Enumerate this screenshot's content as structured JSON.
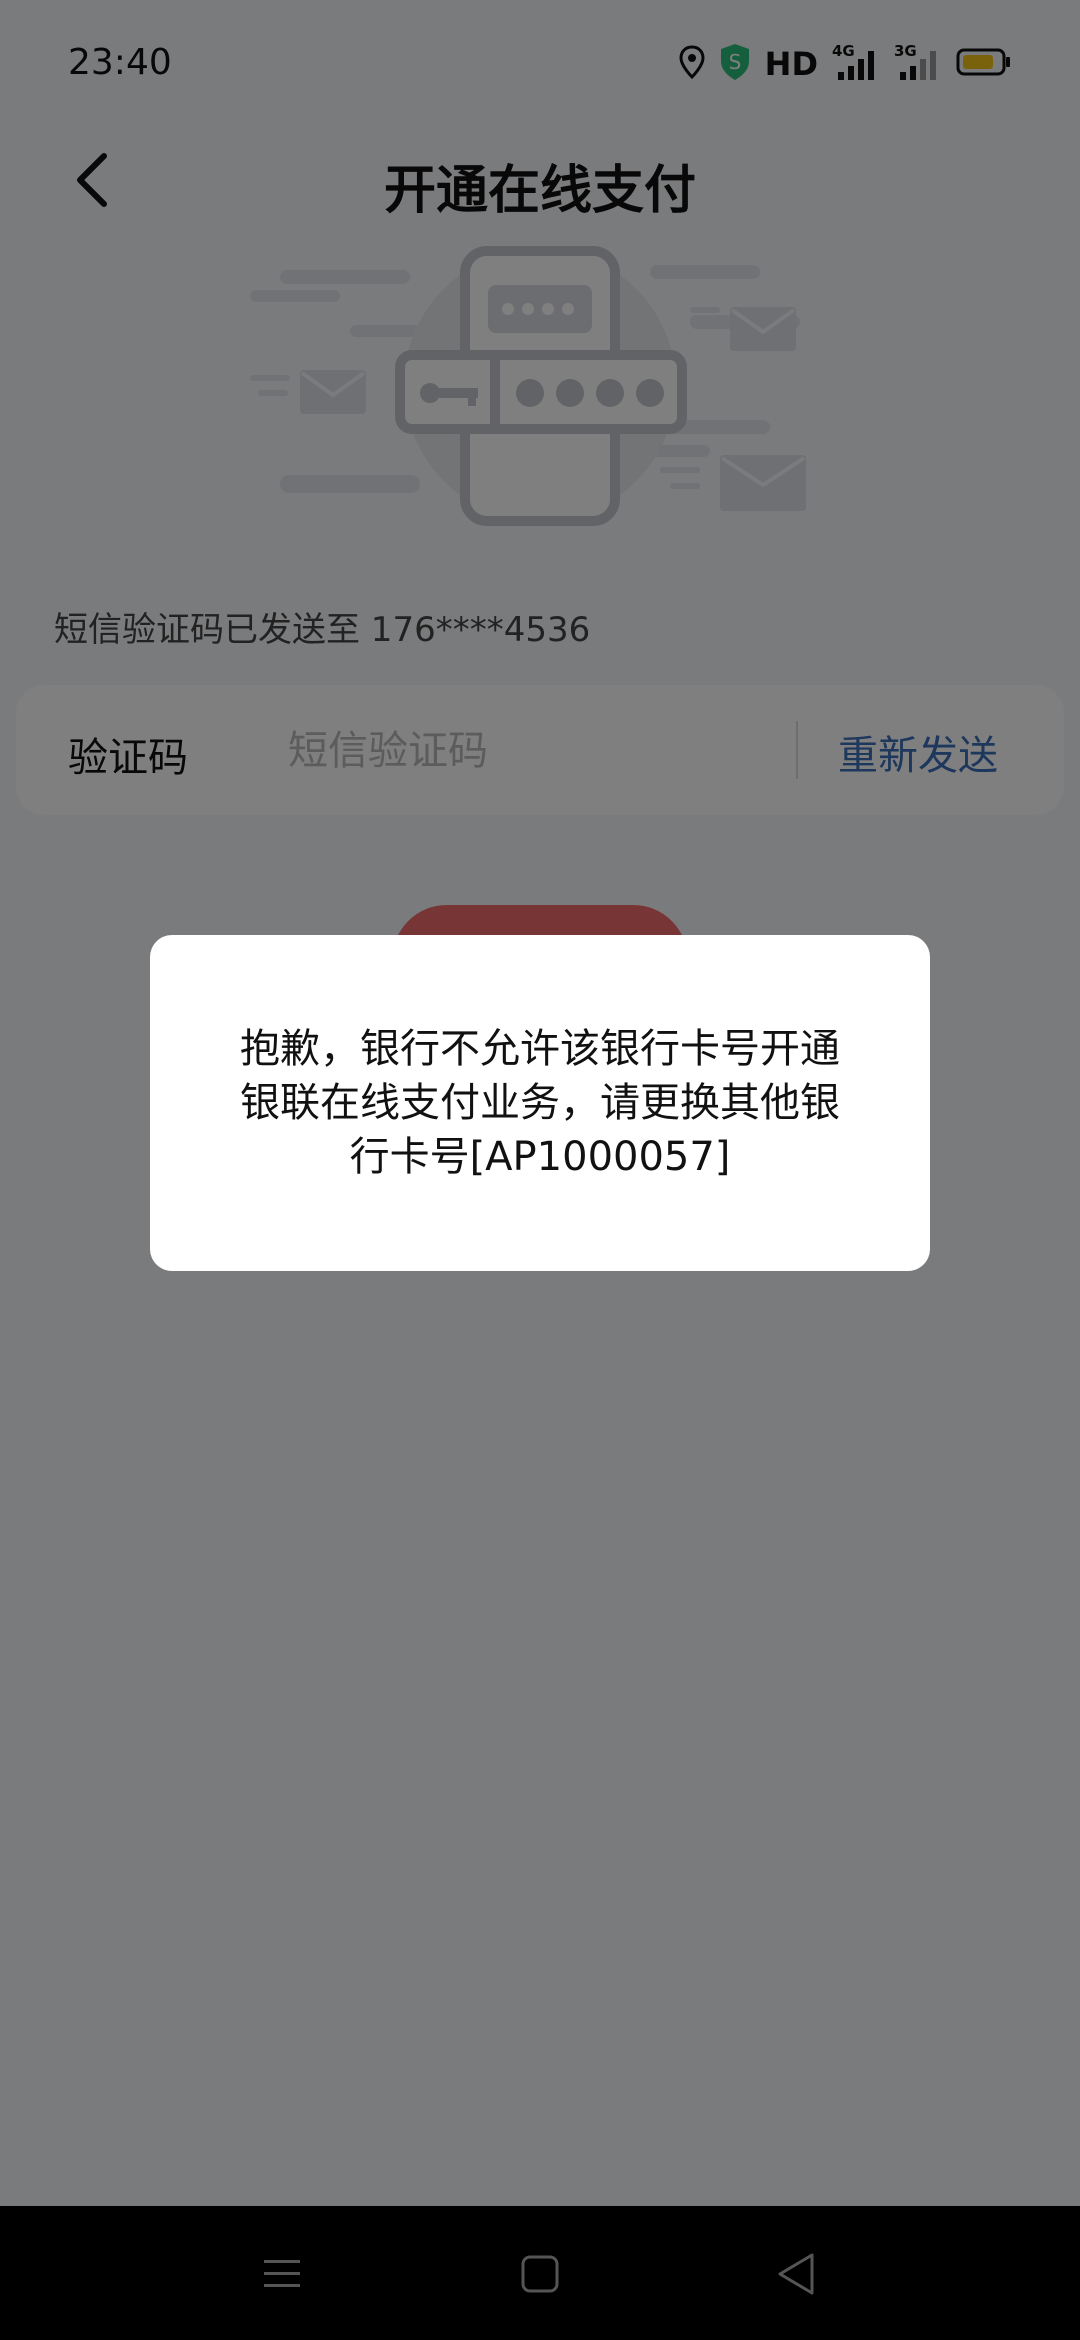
{
  "status_bar": {
    "time": "23:40",
    "hd_label": "HD",
    "net_4g": "4G",
    "net_3g": "3G",
    "icons": [
      "location-icon",
      "security-shield-icon",
      "hd-icon",
      "signal-4g-icon",
      "signal-3g-icon",
      "battery-icon"
    ],
    "battery_color": "#f5c518"
  },
  "nav": {
    "title": "开通在线支付",
    "back_icon": "chevron-left-icon"
  },
  "hero": {
    "icon": "phone-sms-password-illustration"
  },
  "sms": {
    "hint": "短信验证码已发送至 176****4536"
  },
  "verification": {
    "label": "验证码",
    "placeholder": "短信验证码",
    "value": "",
    "resend_label": "重新发送",
    "resend_color": "#3d6fb8"
  },
  "confirm_button": {
    "color": "#f06b6b"
  },
  "dialog": {
    "message": "抱歉，银行不允许该银行卡号开通银联在线支付业务，请更换其他银行卡号[AP1000057]"
  },
  "system_nav": {
    "icons": [
      "menu-icon",
      "home-icon",
      "back-triangle-icon"
    ]
  }
}
